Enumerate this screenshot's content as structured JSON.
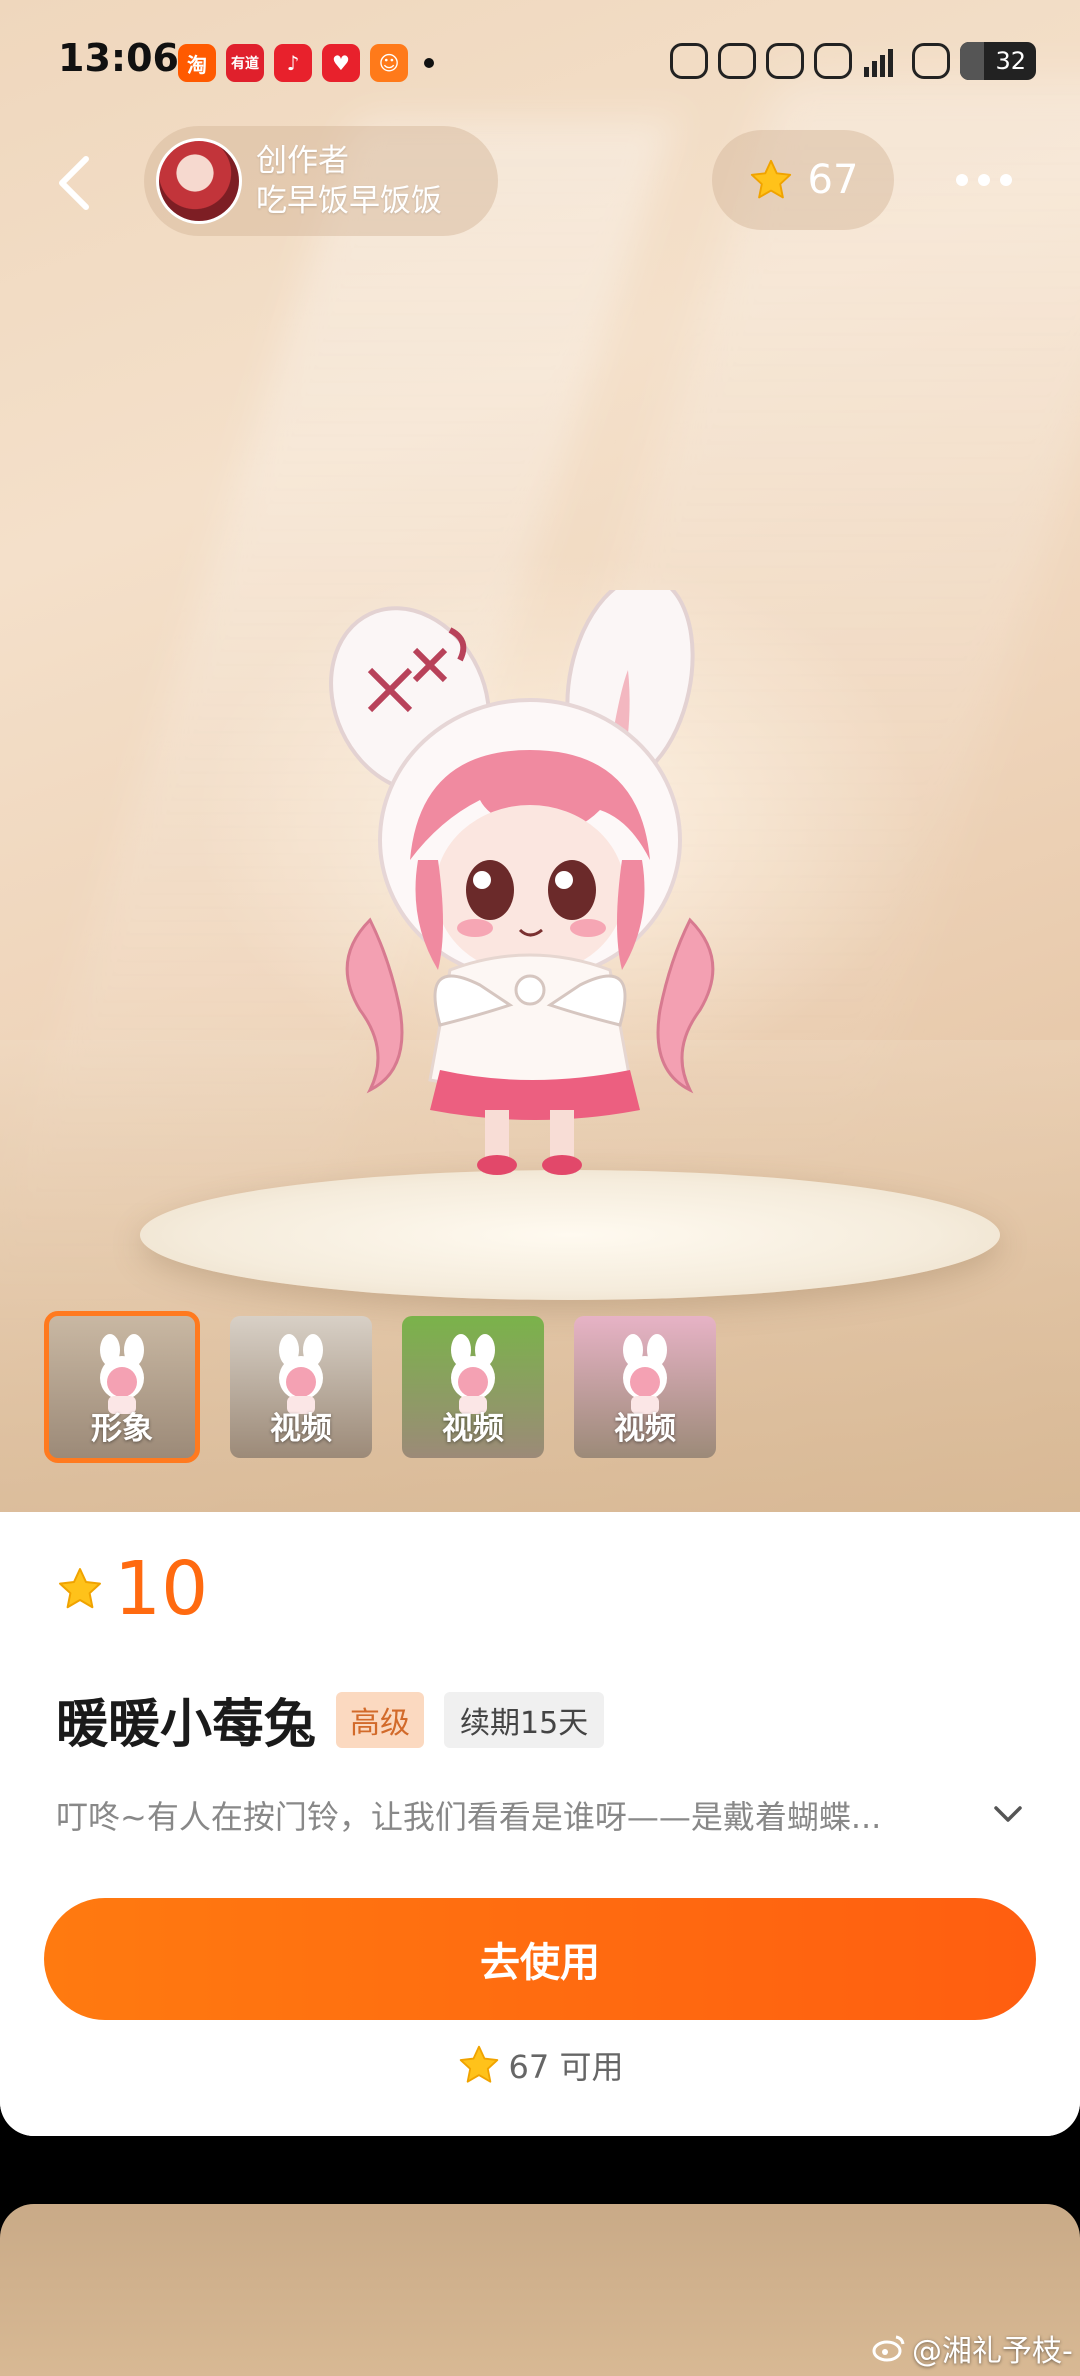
{
  "status_bar": {
    "time": "13:06",
    "battery": "32",
    "battery_level": 0.32,
    "app_icons": [
      {
        "name": "taobao-icon",
        "glyph": "淘",
        "color": "#ff5a00"
      },
      {
        "name": "youdao-icon",
        "glyph": "有道",
        "color": "#e0202c"
      },
      {
        "name": "music-icon",
        "glyph": "♪",
        "color": "#e8212c"
      },
      {
        "name": "health-icon",
        "glyph": "♥",
        "color": "#e8212c"
      },
      {
        "name": "fitness-icon",
        "glyph": "ᗢ",
        "color": "#ff7a1a"
      }
    ]
  },
  "header": {
    "creator_label": "创作者",
    "creator_name": "吃早饭早饭饭",
    "coin_balance": "67"
  },
  "thumbnails": [
    {
      "label": "形象",
      "active": true,
      "bg": "#c9b8a3"
    },
    {
      "label": "视频",
      "active": false,
      "bg": "#d8d0c6"
    },
    {
      "label": "视频",
      "active": false,
      "bg": "#7ab34a"
    },
    {
      "label": "视频",
      "active": false,
      "bg": "#e7b3c6"
    }
  ],
  "product": {
    "price": "10",
    "title": "暖暖小莓兔",
    "tag_level": "高级",
    "tag_term": "续期15天",
    "description": "叮咚~有人在按门铃，让我们看看是谁呀——是戴着蝴蝶..."
  },
  "actions": {
    "use_button": "去使用",
    "available": "67 可用"
  },
  "watermark": "@湘礼予枝-",
  "colors": {
    "accent": "#ff6a10",
    "star": "#ffc21a"
  }
}
